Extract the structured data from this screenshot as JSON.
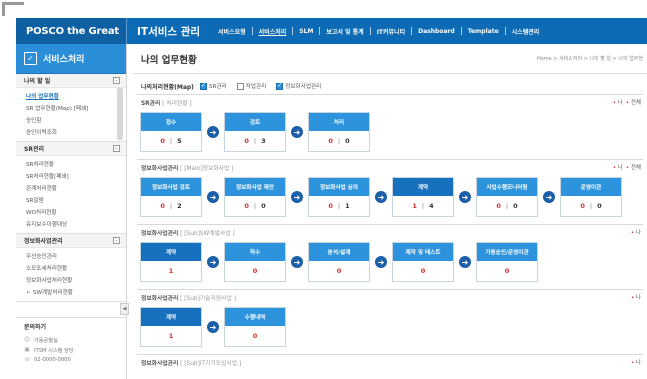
{
  "header": {
    "brand": "POSCO the Great",
    "system_title": "IT서비스 관리",
    "nav": [
      {
        "label": "서비스요청",
        "active": false
      },
      {
        "label": "서비스처리",
        "active": true
      },
      {
        "label": "SLM",
        "active": false
      },
      {
        "label": "보고서 및 통계",
        "active": false
      },
      {
        "label": "IT커뮤니티",
        "active": false
      },
      {
        "label": "Dashboard",
        "active": false
      },
      {
        "label": "Template",
        "active": false
      },
      {
        "label": "시스템관리",
        "active": false
      }
    ]
  },
  "sidebar": {
    "title": "서비스처리",
    "groups": [
      {
        "label": "나의 할 일",
        "toggle": "-",
        "items": [
          {
            "label": "나의 업무현황",
            "current": true
          },
          {
            "label": "SR 업무현황(Map) [폐쇄]",
            "current": false
          },
          {
            "label": "승인함",
            "current": false
          },
          {
            "label": "승인이력조회",
            "current": false
          }
        ]
      },
      {
        "label": "SR관리",
        "toggle": "-",
        "items": [
          {
            "label": "SR처리현황",
            "current": false
          },
          {
            "label": "SR처리현황[폐쇄]",
            "current": false
          },
          {
            "label": "관계처리현황",
            "current": false
          },
          {
            "label": "SR일람",
            "current": false
          },
          {
            "label": "WO처리현황",
            "current": false
          },
          {
            "label": "유지보수이행대상",
            "current": false
          }
        ]
      },
      {
        "label": "정보화사업관리",
        "toggle": "-",
        "items": [
          {
            "label": "무선승인관리",
            "current": false
          },
          {
            "label": "소모조세처리현황",
            "current": false
          },
          {
            "label": "정보화사업처리현황",
            "current": false
          },
          {
            "label": "ㄴ SW계발처리현황",
            "current": false
          }
        ]
      }
    ],
    "contact": {
      "title": "문의하기",
      "rows": [
        {
          "icon": "person-icon",
          "text": "가동운황실"
        },
        {
          "icon": "building-icon",
          "text": "ITSM 시스템 담당"
        },
        {
          "icon": "phone-icon",
          "text": "02-0000-0000"
        }
      ]
    },
    "toggle_label": "◀"
  },
  "main": {
    "title": "나의 업무현황",
    "breadcrumb": "Home > 서비스처리 > 나의 할 일 > 나의 업무현",
    "filters": {
      "title": "나의처리현황(Map)",
      "options": [
        {
          "label": "SR관리",
          "checked": true
        },
        {
          "label": "작업관리",
          "checked": false
        },
        {
          "label": "정보화사업관리",
          "checked": true
        }
      ]
    },
    "sections": [
      {
        "title": "SR관리",
        "subtitle": "[ 처리현황 ]",
        "right": [
          "나",
          "전체"
        ],
        "steps": [
          {
            "label": "접수",
            "left": "0",
            "right": "5",
            "dark": false
          },
          {
            "label": "검토",
            "left": "0",
            "right": "3",
            "dark": false
          },
          {
            "label": "처리",
            "left": "0",
            "right": "0",
            "dark": false
          }
        ]
      },
      {
        "title": "정보화사업관리",
        "subtitle": "[ [Main]정보화사업 ]",
        "right": [
          "나",
          "전체"
        ],
        "steps": [
          {
            "label": "정보화사업 검토",
            "left": "0",
            "right": "2",
            "dark": false
          },
          {
            "label": "정보화사업 제안",
            "left": "0",
            "right": "0",
            "dark": false
          },
          {
            "label": "정보화사업 심의",
            "left": "0",
            "right": "1",
            "dark": false
          },
          {
            "label": "계약",
            "left": "1",
            "right": "4",
            "dark": true
          },
          {
            "label": "사업수행모니터링",
            "left": "0",
            "right": "0",
            "dark": false
          },
          {
            "label": "운영이관",
            "left": "0",
            "right": "0",
            "dark": false
          }
        ]
      },
      {
        "title": "정보화사업관리",
        "subtitle": "[ [Sub]SW계발사업 ]",
        "right": [
          "나"
        ],
        "steps": [
          {
            "label": "계약",
            "single": "1",
            "dark": true
          },
          {
            "label": "착수",
            "single": "0",
            "dark": false
          },
          {
            "label": "분석/설계",
            "single": "0",
            "dark": false
          },
          {
            "label": "제작 및 테스트",
            "single": "0",
            "dark": false
          },
          {
            "label": "가동승인/운영이관",
            "single": "0",
            "dark": false
          }
        ]
      },
      {
        "title": "정보화사업관리",
        "subtitle": "[ [Sub]기술지원사업 ]",
        "right": [
          "나"
        ],
        "steps": [
          {
            "label": "계약",
            "single": "1",
            "dark": true
          },
          {
            "label": "수행내역",
            "single": "0",
            "dark": false
          }
        ]
      },
      {
        "title": "정보화사업관리",
        "subtitle": "[ [Sub]IT가기도입사업 ]",
        "right": [
          "나"
        ],
        "steps": []
      }
    ]
  }
}
